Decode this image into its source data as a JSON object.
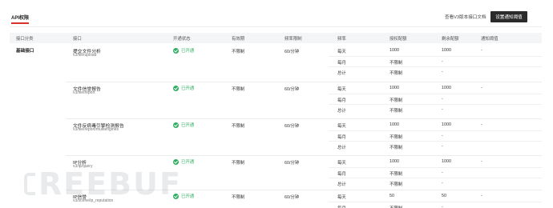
{
  "header": {
    "active_tab": "API权限",
    "doc_link": "查看V3版本接口文档",
    "settings_button": "设置通知阈值"
  },
  "table": {
    "columns": [
      "接口分类",
      "接口",
      "开通状态",
      "有效期",
      "频率限制",
      "频率",
      "授权配额",
      "剩余配额",
      "通知阈值"
    ],
    "category": "基础接口",
    "rows": [
      {
        "name": "提交文件分析",
        "path": "v3/file/upload",
        "status": "已开通",
        "validity": "不限制",
        "rate_limit": "60/分钟",
        "threshold": "-",
        "quotas": [
          {
            "period": "每天",
            "granted": "1000",
            "remaining": "1000"
          },
          {
            "period": "每月",
            "granted": "不限制",
            "remaining": "-"
          },
          {
            "period": "总计",
            "granted": "不限制",
            "remaining": "-"
          }
        ]
      },
      {
        "name": "文件信誉报告",
        "path": "v3/file/report",
        "status": "已开通",
        "validity": "不限制",
        "rate_limit": "60/分钟",
        "threshold": "-",
        "quotas": [
          {
            "period": "每天",
            "granted": "1000",
            "remaining": "1000"
          },
          {
            "period": "每月",
            "granted": "不限制",
            "remaining": "-"
          },
          {
            "period": "总计",
            "granted": "不限制",
            "remaining": "-"
          }
        ]
      },
      {
        "name": "文件反病毒引擎检测报告",
        "path": "v3/file/report/multiengines",
        "status": "已开通",
        "validity": "不限制",
        "rate_limit": "60/分钟",
        "threshold": "-",
        "quotas": [
          {
            "period": "每天",
            "granted": "1000",
            "remaining": "1000"
          },
          {
            "period": "每月",
            "granted": "不限制",
            "remaining": "-"
          },
          {
            "period": "总计",
            "granted": "不限制",
            "remaining": "-"
          }
        ]
      },
      {
        "name": "IP分析",
        "path": "v3/ip/query",
        "status": "已开通",
        "validity": "不限制",
        "rate_limit": "60/分钟",
        "threshold": "-",
        "quotas": [
          {
            "period": "每天",
            "granted": "1000",
            "remaining": "1000"
          },
          {
            "period": "每月",
            "granted": "不限制",
            "remaining": "-"
          },
          {
            "period": "总计",
            "granted": "不限制",
            "remaining": "-"
          }
        ]
      },
      {
        "name": "IP信誉",
        "path": "v3/scene/ip_reputation",
        "status": "已开通",
        "validity": "不限制",
        "rate_limit": "60/分钟",
        "threshold": "-",
        "quotas": [
          {
            "period": "每天",
            "granted": "50",
            "remaining": "50"
          },
          {
            "period": "每月",
            "granted": "不限制",
            "remaining": "-"
          }
        ]
      }
    ]
  },
  "watermark": {
    "text": "REEBUF"
  },
  "colors": {
    "accent": "#d8322c",
    "success": "#2fae62",
    "header_bg": "#f4f5f7",
    "button_bg": "#2b2b2b"
  }
}
